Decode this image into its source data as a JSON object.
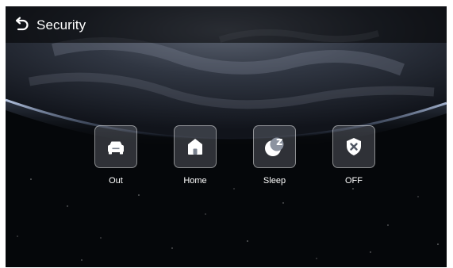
{
  "header": {
    "back_icon": "back-arrow-icon",
    "title": "Security"
  },
  "modes": [
    {
      "label": "Out",
      "icon": "car-icon"
    },
    {
      "label": "Home",
      "icon": "house-icon"
    },
    {
      "label": "Sleep",
      "icon": "moon-sleep-icon"
    },
    {
      "label": "OFF",
      "icon": "shield-off-icon"
    }
  ],
  "colors": {
    "text": "#ffffff",
    "background": "#050608",
    "tile": "#d7deec"
  }
}
